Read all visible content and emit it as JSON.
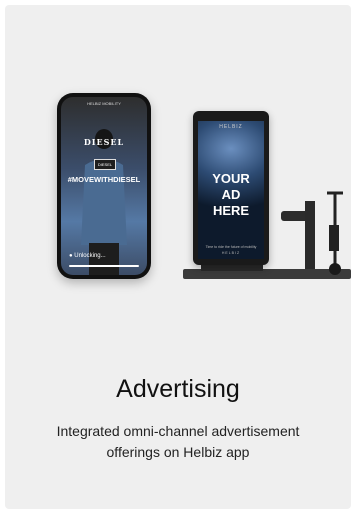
{
  "hero": {
    "phone": {
      "status_text": "HELBIZ MOBILITY",
      "brand": "DIESEL",
      "patch_text": "DIESEL",
      "hashtag": "#MOVEWITHDIESEL",
      "unlock_text": "Unlocking..."
    },
    "kiosk": {
      "brand": "HELBIZ",
      "headline_line1": "YOUR",
      "headline_line2": "AD",
      "headline_line3": "HERE",
      "fine_print": "Time to ride the future of mobility",
      "fine_print_brand": "HELBIZ"
    }
  },
  "section": {
    "title": "Advertising",
    "description": "Integrated omni-channel advertisement offerings on Helbiz app"
  },
  "colors": {
    "card_background": "#efefef",
    "text_primary": "#111111"
  }
}
